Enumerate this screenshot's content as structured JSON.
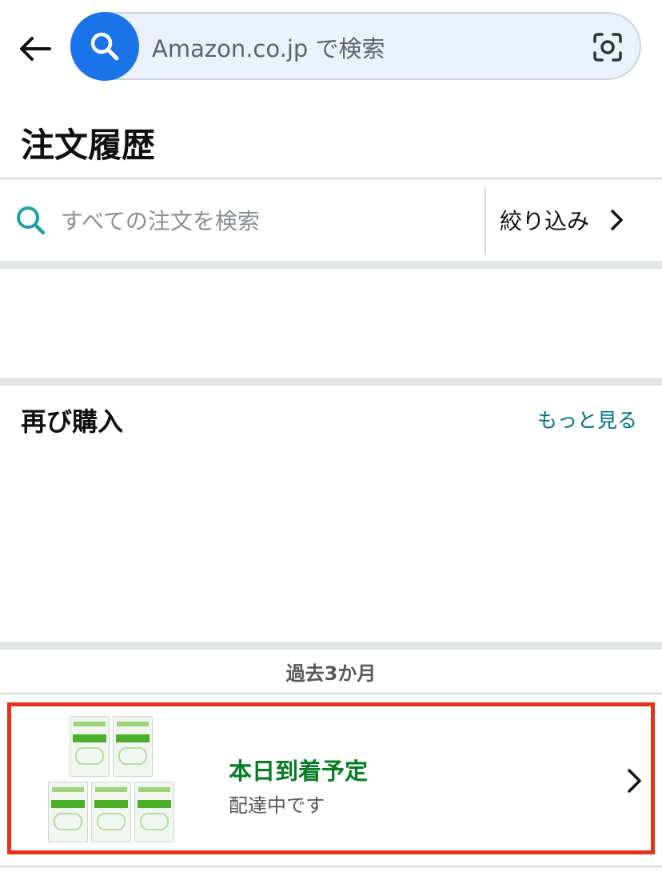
{
  "header": {
    "search_placeholder": "Amazon.co.jp で検索"
  },
  "page_title": "注文履歴",
  "order_search": {
    "placeholder": "すべての注文を検索",
    "filter_label": "絞り込み"
  },
  "buy_again": {
    "title": "再び購入",
    "see_more": "もっと見る"
  },
  "period_label": "過去3か月",
  "orders": [
    {
      "status": "本日到着予定",
      "substatus": "配達中です",
      "product_image": "5-pack plastic bag product thumbnails"
    }
  ],
  "colors": {
    "search_button": "#1a73e8",
    "link": "#007185",
    "delivery_status": "#067d22",
    "highlight_border": "#e8311a"
  }
}
